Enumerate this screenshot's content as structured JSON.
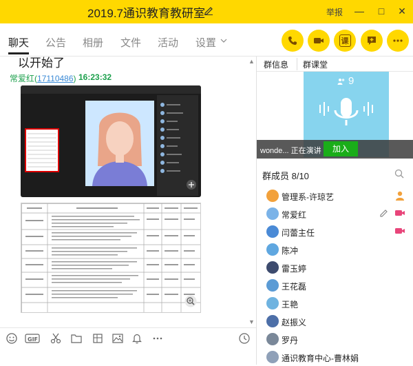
{
  "window": {
    "title": "2019.7通识教育教研室",
    "report_label": "举报"
  },
  "tabs": [
    {
      "label": "聊天",
      "active": true
    },
    {
      "label": "公告",
      "active": false
    },
    {
      "label": "相册",
      "active": false
    },
    {
      "label": "文件",
      "active": false
    },
    {
      "label": "活动",
      "active": false
    },
    {
      "label": "设置",
      "active": false
    }
  ],
  "chat": {
    "previous_message_tail": "以开始了",
    "sender_name": "常爱红",
    "sender_id": "17110486",
    "time": "16:23:32"
  },
  "right_tabs": [
    "群信息",
    "群课堂"
  ],
  "live": {
    "viewer_count": "9",
    "status_text": "wonde... 正在演讲",
    "join_label": "加入"
  },
  "members": {
    "title": "群成员 8/10",
    "list": [
      {
        "name": "管理系-许琼艺",
        "avatar_color": "#f2a13b",
        "extra": "person"
      },
      {
        "name": "常爱红",
        "avatar_color": "#7bb3e8",
        "extra": "edit-video"
      },
      {
        "name": "闫蕾主任",
        "avatar_color": "#4a8ad6",
        "extra": "video"
      },
      {
        "name": "陈冲",
        "avatar_color": "#5fa7e0",
        "extra": ""
      },
      {
        "name": "雷玉婷",
        "avatar_color": "#3d4b6e",
        "extra": ""
      },
      {
        "name": "王花磊",
        "avatar_color": "#5b9bd5",
        "extra": ""
      },
      {
        "name": "王艳",
        "avatar_color": "#6fb3e0",
        "extra": ""
      },
      {
        "name": "赵振义",
        "avatar_color": "#4d6fa8",
        "extra": ""
      },
      {
        "name": "罗丹",
        "avatar_color": "#7a8899",
        "extra": ""
      },
      {
        "name": "通识教育中心-曹林娟",
        "avatar_color": "#8fa0b8",
        "extra": ""
      }
    ]
  },
  "colors": {
    "brand_yellow": "#ffd800",
    "sender_green": "#1ca04c",
    "link_blue": "#3a8ad6",
    "live_blue": "#87d4ee",
    "join_green": "#1aad19",
    "video_pink": "#e8457a"
  }
}
